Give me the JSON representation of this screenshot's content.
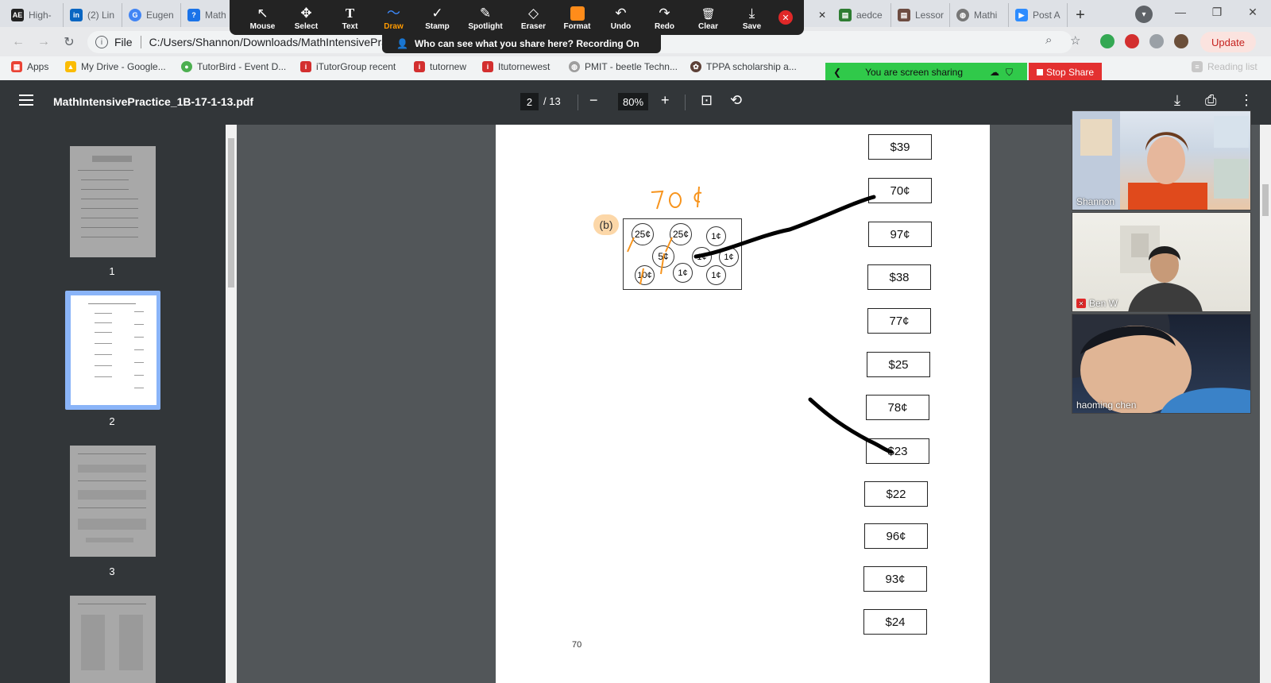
{
  "browser": {
    "tabs": [
      {
        "label": "High-",
        "icon": "ae-icon",
        "color": "#222222"
      },
      {
        "label": "(2) Lin",
        "icon": "linkedin-icon",
        "color": "#0a66c2"
      },
      {
        "label": "Eugen",
        "icon": "chrome-icon",
        "color": "#4285f4"
      },
      {
        "label": "Math",
        "icon": "mathtutor-icon",
        "color": "#1a73e8"
      },
      {
        "label": "aedce",
        "icon": "doc-icon",
        "color": "#2e7d32"
      },
      {
        "label": "Lessor",
        "icon": "doc-icon",
        "color": "#6d4c41"
      },
      {
        "label": "Mathi",
        "icon": "globe-icon",
        "color": "#777777"
      },
      {
        "label": "Post A",
        "icon": "zoom-icon",
        "color": "#2d8cff"
      }
    ],
    "url_scheme": "File",
    "url": "C:/Users/Shannon/Downloads/MathIntensivePrac",
    "update_label": "Update",
    "bookmarks": [
      {
        "label": "Apps",
        "color": "#ea4335"
      },
      {
        "label": "My Drive - Google...",
        "color": "#fbbc04"
      },
      {
        "label": "TutorBird - Event D...",
        "color": "#4caf50"
      },
      {
        "label": "iTutorGroup recent",
        "color": "#d32f2f"
      },
      {
        "label": "tutornew",
        "color": "#d32f2f"
      },
      {
        "label": "Itutornewest",
        "color": "#d32f2f"
      },
      {
        "label": "PMIT - beetle Techn...",
        "color": "#9e9e9e"
      },
      {
        "label": "TPPA scholarship a...",
        "color": "#5d4037"
      }
    ],
    "reading_list": "Reading list"
  },
  "zoom_toolbar": {
    "tools": [
      {
        "label": "Mouse",
        "icon": "↖"
      },
      {
        "label": "Select",
        "icon": "✥"
      },
      {
        "label": "Text",
        "icon": "T"
      },
      {
        "label": "Draw",
        "icon": "〜"
      },
      {
        "label": "Stamp",
        "icon": "✓"
      },
      {
        "label": "Spotlight",
        "icon": "✎"
      },
      {
        "label": "Eraser",
        "icon": "◇"
      },
      {
        "label": "Format",
        "icon": ""
      },
      {
        "label": "Undo",
        "icon": "↶"
      },
      {
        "label": "Redo",
        "icon": "↷"
      },
      {
        "label": "Clear",
        "icon": "🗑"
      },
      {
        "label": "Save",
        "icon": "⤓"
      }
    ],
    "active_tool": "Draw",
    "recording_banner": "Who can see what you share here? Recording On",
    "sharing_text": "You are screen sharing",
    "stop_share": "Stop Share"
  },
  "pdf_viewer": {
    "filename": "MathIntensivePractice_1B-17-1-13.pdf",
    "current_page": "2",
    "total_pages": "/ 13",
    "zoom": "80%",
    "thumbnail_numbers": [
      "1",
      "2",
      "3"
    ]
  },
  "document": {
    "prices": [
      "$39",
      "70¢",
      "97¢",
      "$38",
      "77¢",
      "$25",
      "78¢",
      "$23",
      "$22",
      "96¢",
      "93¢",
      "$24"
    ],
    "part_label": "(b)",
    "coins": [
      "25¢",
      "25¢",
      "1¢",
      "5¢",
      "1¢",
      "1¢",
      "10¢",
      "1¢",
      "1¢"
    ],
    "handwritten_answer": "70¢",
    "page_number": "70"
  },
  "participants": [
    {
      "name": "Shannon",
      "muted": false
    },
    {
      "name": "Ben W",
      "muted": true
    },
    {
      "name": "haoming   chen",
      "muted": false
    }
  ],
  "colors": {
    "annotation_orange": "#f7941d",
    "draw_black": "#000000",
    "share_green": "#30c94a",
    "stop_red": "#e33030",
    "pdf_toolbar": "#323639"
  }
}
